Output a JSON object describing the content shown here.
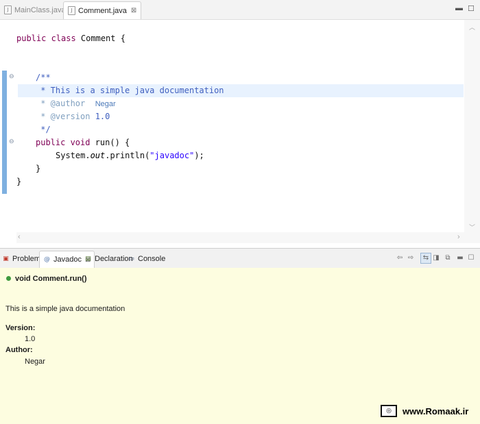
{
  "editor": {
    "tabs": [
      {
        "label": "MainClass.java",
        "icon": "java-file-icon",
        "active": false
      },
      {
        "label": "Comment.java",
        "icon": "java-file-icon",
        "active": true,
        "close": "⊠"
      }
    ],
    "window_controls": {
      "minimize": "▬",
      "maximize": "☐"
    },
    "code": {
      "l1": {
        "kw": "public class",
        "rest": " Comment {"
      },
      "l2": "/**",
      "l3": " * This is a simple java documentation",
      "l4_tag": " * @author",
      "l4_value": "Negar",
      "l5_tag": " * @version",
      "l5_value": " 1.0",
      "l6": " */",
      "l7": {
        "kw": "public void",
        "rest": " run() {"
      },
      "l8": {
        "a": "System.",
        "b": "out",
        "c": ".println(",
        "d": "\"javadoc\"",
        "e": ");"
      },
      "l9": "}",
      "l10": "}"
    }
  },
  "panel": {
    "tabs": [
      {
        "label": "Problems",
        "icon": "problems-icon",
        "active": false
      },
      {
        "label": "Javadoc",
        "icon": "at-sign-icon",
        "active": true,
        "close": "⊠"
      },
      {
        "label": "Declaration",
        "icon": "declaration-icon",
        "active": false
      },
      {
        "label": "Console",
        "icon": "console-icon",
        "active": false
      }
    ],
    "toolbar": [
      "back-icon",
      "forward-icon",
      "link-with-editor-icon",
      "open-declaration-icon",
      "open-external-icon"
    ]
  },
  "javadoc": {
    "signature": "void Comment.run()",
    "description": "This is a simple java documentation",
    "version_label": "Version:",
    "version_value": "1.0",
    "author_label": "Author:",
    "author_value": "Negar"
  },
  "watermark": {
    "text": "www.Romaak.ir"
  },
  "colors": {
    "keyword": "#7f0055",
    "javadoc": "#3f5fbf",
    "javadoc_tag": "#7f9fbf",
    "string": "#2a00ff",
    "javadoc_panel_bg": "#fdfde0",
    "highlight_line": "#e8f2fe"
  }
}
